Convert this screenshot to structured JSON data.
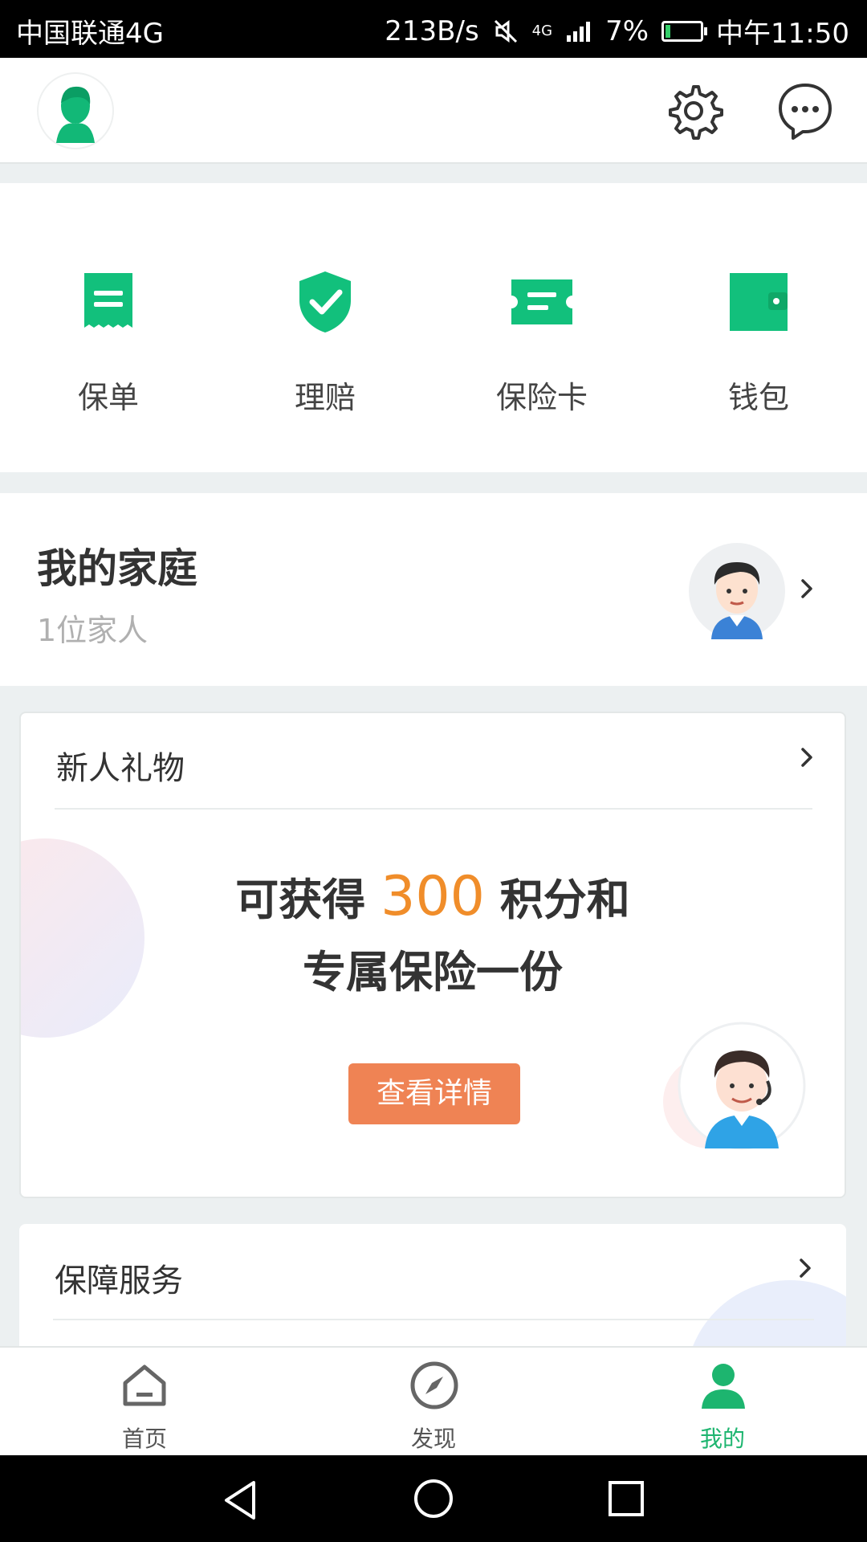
{
  "status_bar": {
    "carrier": "中国联通4G",
    "net_speed": "213B/s",
    "network_type": "4G",
    "battery": "7%",
    "time": "中午11:50"
  },
  "header": {
    "icons": [
      "avatar-icon",
      "gear-icon",
      "message-icon"
    ]
  },
  "quick_actions": [
    {
      "label": "保单",
      "icon": "policy-icon"
    },
    {
      "label": "理赔",
      "icon": "shield-check-icon"
    },
    {
      "label": "保险卡",
      "icon": "insurance-card-icon"
    },
    {
      "label": "钱包",
      "icon": "wallet-icon"
    }
  ],
  "family": {
    "title": "我的家庭",
    "count": "1位家人"
  },
  "gift": {
    "title": "新人礼物",
    "line1_prefix": "可获得",
    "points": "300",
    "line1_suffix": "积分和",
    "line2": "专属保险一份",
    "button": "查看详情"
  },
  "service": {
    "title": "保障服务"
  },
  "bottom_nav": [
    {
      "label": "首页",
      "icon": "home-icon",
      "active": false
    },
    {
      "label": "发现",
      "icon": "compass-icon",
      "active": false
    },
    {
      "label": "我的",
      "icon": "person-icon",
      "active": true
    }
  ],
  "colors": {
    "accent_green": "#1db56f",
    "points_orange": "#f08d2a",
    "button_orange": "#ef8354"
  }
}
